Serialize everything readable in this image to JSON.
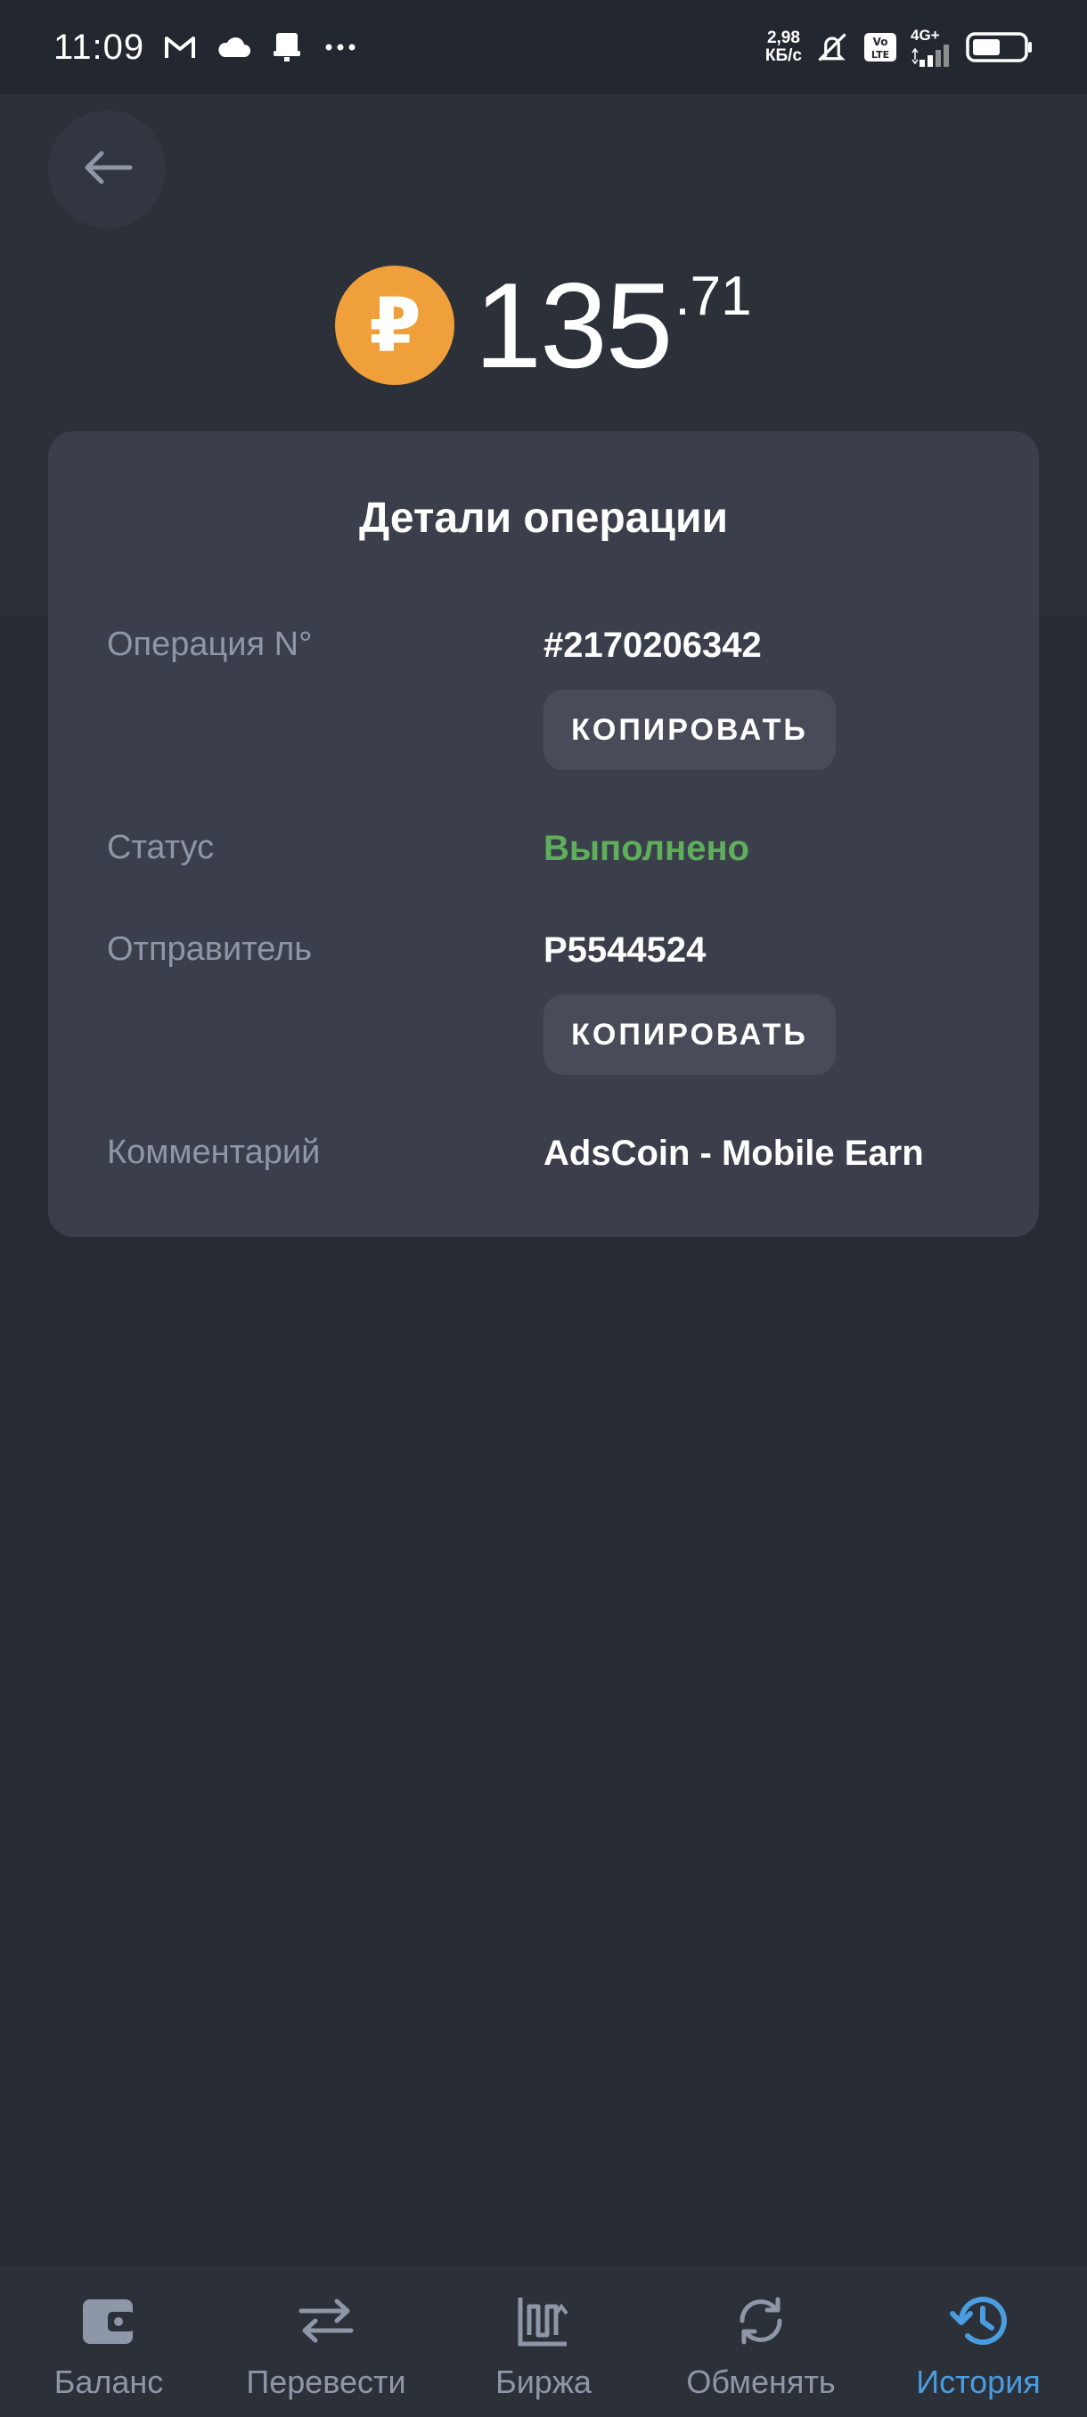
{
  "status_bar": {
    "time": "11:09",
    "speed_value": "2,98",
    "speed_unit": "КБ/с",
    "volte": "Vo LTE",
    "network": "4G+",
    "icons": [
      "gmail-icon",
      "cloud-icon",
      "notification-icon",
      "more-icon",
      "mute-icon",
      "signal-icon",
      "battery-icon"
    ]
  },
  "header": {
    "back_icon": "arrow-left-icon",
    "coin_symbol": "₽",
    "amount_integer": "135",
    "amount_fraction": ".71"
  },
  "details": {
    "title": "Детали операции",
    "operation_label": "Операция N°",
    "operation_value": "#2170206342",
    "copy_label": "КОПИРОВАТЬ",
    "status_label": "Статус",
    "status_value": "Выполнено",
    "sender_label": "Отправитель",
    "sender_value": "P5544524",
    "comment_label": "Комментарий",
    "comment_value": "AdsCoin - Mobile Earn"
  },
  "nav": {
    "items": [
      {
        "label": "Баланс",
        "icon": "wallet-icon"
      },
      {
        "label": "Перевести",
        "icon": "transfer-icon"
      },
      {
        "label": "Биржа",
        "icon": "exchange-chart-icon"
      },
      {
        "label": "Обменять",
        "icon": "swap-icon"
      },
      {
        "label": "История",
        "icon": "history-icon"
      }
    ],
    "active": "История"
  },
  "colors": {
    "background": "#272b34",
    "card": "#3a3f4b",
    "coin": "#f0a03a",
    "status_ok": "#5fae5c",
    "active_nav": "#4a9de0",
    "muted_text": "#8e97a8"
  }
}
